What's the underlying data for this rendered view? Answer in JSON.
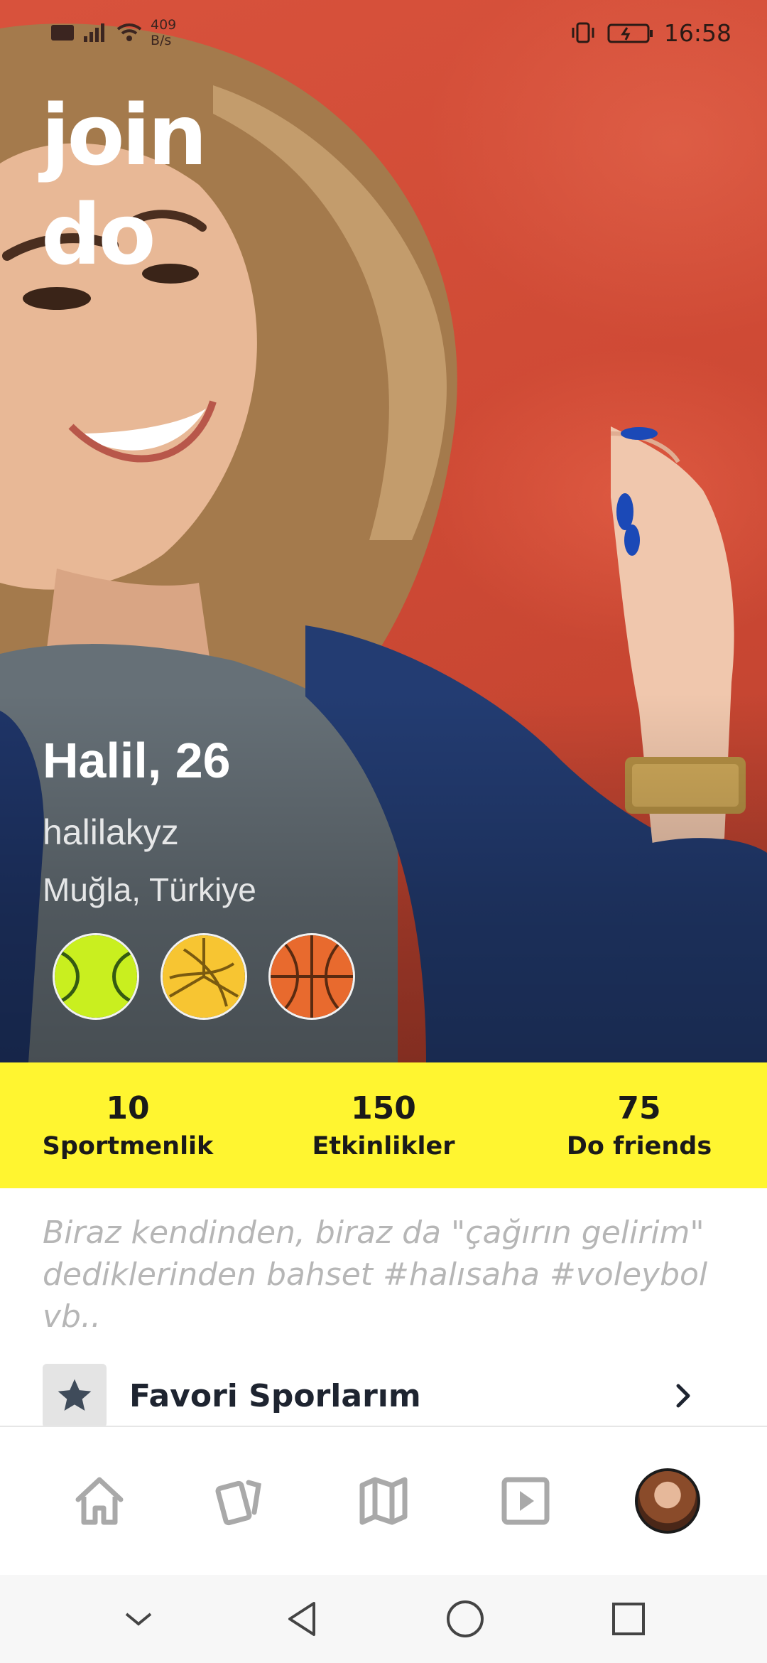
{
  "status_bar": {
    "net_speed_value": "409",
    "net_speed_unit": "B/s",
    "time": "16:58"
  },
  "brand": {
    "logo_text": "join do"
  },
  "profile": {
    "name_age": "Halil, 26",
    "username": "halilakyz",
    "location": "Muğla, Türkiye",
    "sports": [
      {
        "icon": "tennis-ball-icon",
        "color": "#c9ef1f"
      },
      {
        "icon": "volleyball-icon",
        "color": "#f7c532"
      },
      {
        "icon": "basketball-icon",
        "color": "#e86a2e"
      }
    ]
  },
  "stats": [
    {
      "value": "10",
      "label": "Sportmenlik"
    },
    {
      "value": "150",
      "label": "Etkinlikler"
    },
    {
      "value": "75",
      "label": "Do friends"
    }
  ],
  "bio_placeholder": "Biraz kendinden, biraz da \"çağırın gelirim\" dediklerinden bahset #halısaha #voleybol vb..",
  "favorites": {
    "label": "Favori Sporlarım",
    "icon": "star-icon"
  },
  "bottom_nav": [
    {
      "icon": "home-icon"
    },
    {
      "icon": "cards-icon"
    },
    {
      "icon": "map-icon"
    },
    {
      "icon": "play-icon"
    },
    {
      "icon": "profile-avatar"
    }
  ],
  "colors": {
    "accent_yellow": "#fff530",
    "hero_red": "#cf4a35",
    "text_dark": "#1e2430",
    "placeholder_gray": "#b6b6b6"
  }
}
